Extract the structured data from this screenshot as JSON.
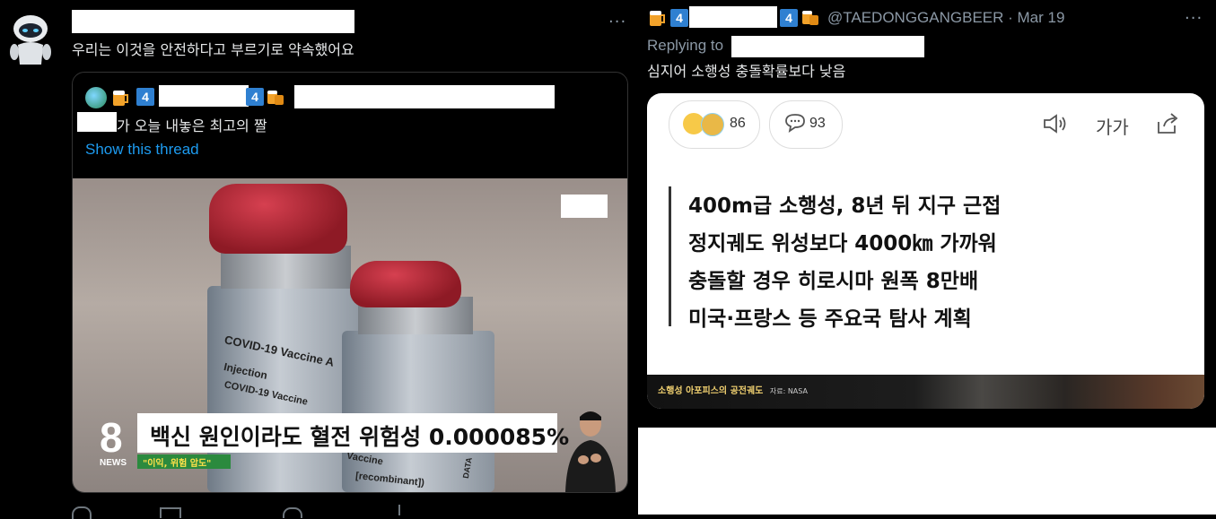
{
  "left_tweet": {
    "body": "우리는 이것을 안전하다고 부르기로 약속했어요",
    "more": "···",
    "quoted": {
      "badge": "4",
      "text_suffix": "가 오늘 내놓은 최고의 짤",
      "show_thread": "Show this thread",
      "news": {
        "headline": "백신 원인이라도 혈전 위험성 0.000085%",
        "subcaption": "\"이익, 위험 압도\"",
        "channel_number": "8",
        "channel_label": "NEWS",
        "vial_label_1": "COVID-19 Vaccine A",
        "vial_label_2": "Injection",
        "vial_label_3": "COVID-19 Vaccine",
        "vial_label_4": "Vaccine",
        "vial_label_5": "[recombinant])",
        "vial_label_6": "DATA"
      }
    }
  },
  "right_tweet": {
    "badge": "4",
    "handle": "@TAEDONGGANGBEER · Mar 19",
    "more": "···",
    "replying_to": "Replying to",
    "body": "심지어 소행성 충돌확률보다 낮음",
    "article": {
      "reaction_count": "86",
      "comment_count": "93",
      "font_size_label": "가가",
      "lines": [
        "400m급 소행성, 8년 뒤 지구 근접",
        "정지궤도 위성보다 4000㎞ 가까워",
        "충돌할 경우 히로시마 원폭 8만배",
        "미국·프랑스 등 주요국 탐사 계획"
      ],
      "caption": "소행성 아포피스의 공전궤도",
      "caption_source": "자료: NASA"
    }
  },
  "colors": {
    "background": "#000000",
    "link": "#1d9bf0",
    "badge": "#2f80d1",
    "muted": "#8b98a5"
  }
}
